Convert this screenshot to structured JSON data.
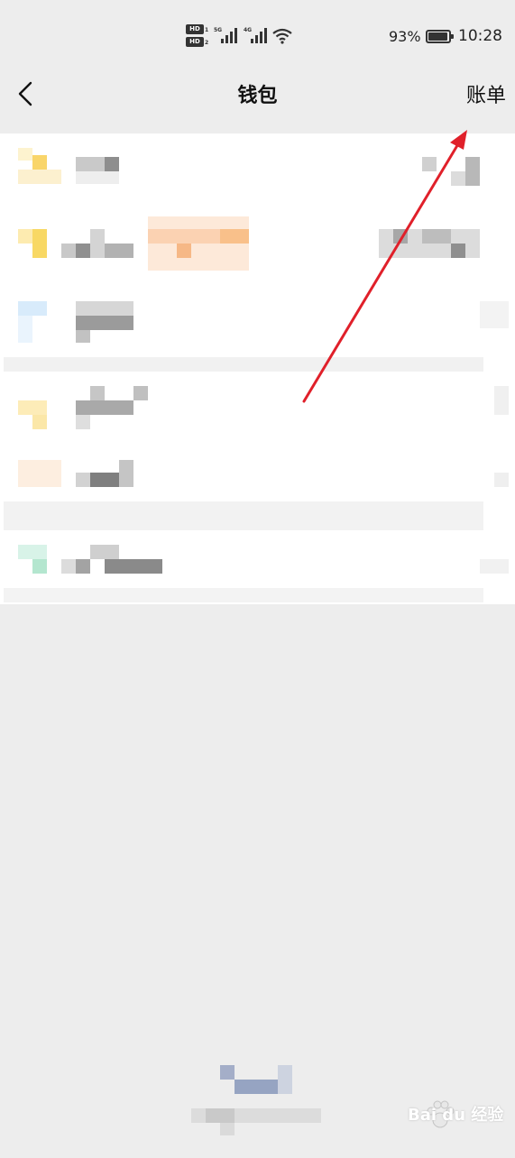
{
  "status_bar": {
    "hd1": "HD",
    "hd1_sub": "1",
    "hd2": "HD",
    "hd2_sub": "2",
    "net1": "5G",
    "net2": "4G",
    "battery": "93%",
    "time": "10:28"
  },
  "nav": {
    "title": "钱包",
    "right_label": "账单",
    "back_icon": "chevron-left-icon"
  },
  "watermark": "Bai du 经验",
  "colors": {
    "background": "#ededed",
    "card": "#ffffff",
    "arrow": "#e0202a",
    "watermark_paw": "#e8e8e8"
  }
}
